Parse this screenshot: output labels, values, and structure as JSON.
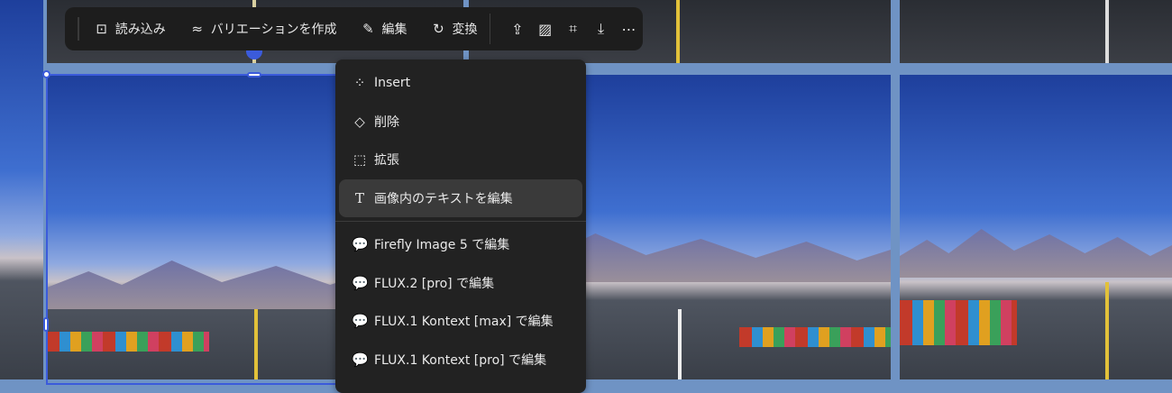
{
  "toolbar": {
    "import_label": "読み込み",
    "variations_label": "バリエーションを作成",
    "edit_label": "編集",
    "transform_label": "変換",
    "icons": [
      "terminal-icon",
      "approx-icon",
      "pencil-icon",
      "rotate-sparkle-icon",
      "generate-icon",
      "image-icon",
      "crop-icon",
      "download-icon",
      "more-icon"
    ]
  },
  "menu": {
    "items": [
      {
        "label": "Insert",
        "icon": "insert-sparkle-icon"
      },
      {
        "label": "削除",
        "icon": "eraser-icon"
      },
      {
        "label": "拡張",
        "icon": "expand-icon"
      },
      {
        "label": "画像内のテキストを編集",
        "icon": "text-edit-icon",
        "highlighted": true
      },
      {
        "label": "Firefly Image 5 で編集",
        "icon": "chat-sparkle-icon"
      },
      {
        "label": "FLUX.2 [pro] で編集",
        "icon": "chat-sparkle-icon"
      },
      {
        "label": "FLUX.1 Kontext [max] で編集",
        "icon": "chat-sparkle-icon"
      },
      {
        "label": "FLUX.1 Kontext [pro] で編集",
        "icon": "chat-sparkle-icon"
      }
    ]
  },
  "colors": {
    "selection": "#3b5bdb",
    "toolbar_bg": "#1d1d1d",
    "menu_bg": "#222222"
  }
}
